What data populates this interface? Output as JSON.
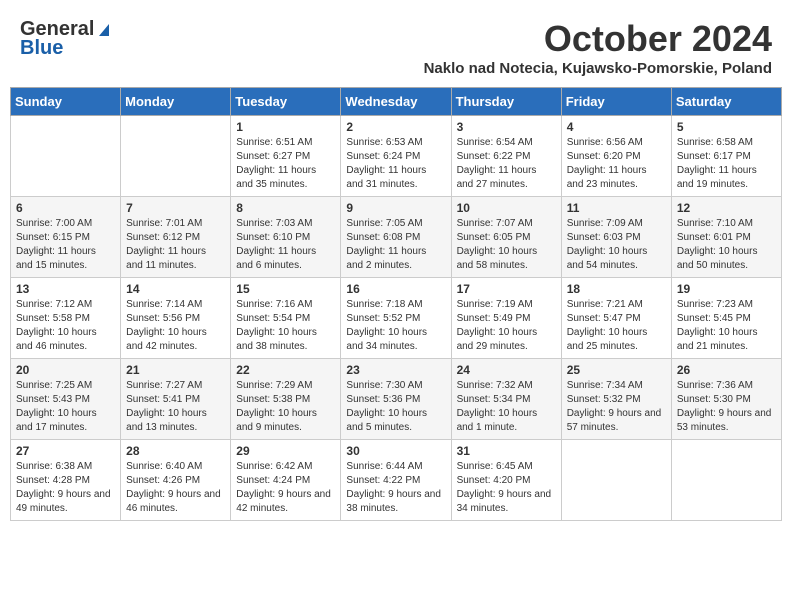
{
  "header": {
    "logo_general": "General",
    "logo_blue": "Blue",
    "month_title": "October 2024",
    "location": "Naklo nad Notecia, Kujawsko-Pomorskie, Poland"
  },
  "days_of_week": [
    "Sunday",
    "Monday",
    "Tuesday",
    "Wednesday",
    "Thursday",
    "Friday",
    "Saturday"
  ],
  "weeks": [
    [
      {
        "day": "",
        "info": ""
      },
      {
        "day": "",
        "info": ""
      },
      {
        "day": "1",
        "info": "Sunrise: 6:51 AM\nSunset: 6:27 PM\nDaylight: 11 hours and 35 minutes."
      },
      {
        "day": "2",
        "info": "Sunrise: 6:53 AM\nSunset: 6:24 PM\nDaylight: 11 hours and 31 minutes."
      },
      {
        "day": "3",
        "info": "Sunrise: 6:54 AM\nSunset: 6:22 PM\nDaylight: 11 hours and 27 minutes."
      },
      {
        "day": "4",
        "info": "Sunrise: 6:56 AM\nSunset: 6:20 PM\nDaylight: 11 hours and 23 minutes."
      },
      {
        "day": "5",
        "info": "Sunrise: 6:58 AM\nSunset: 6:17 PM\nDaylight: 11 hours and 19 minutes."
      }
    ],
    [
      {
        "day": "6",
        "info": "Sunrise: 7:00 AM\nSunset: 6:15 PM\nDaylight: 11 hours and 15 minutes."
      },
      {
        "day": "7",
        "info": "Sunrise: 7:01 AM\nSunset: 6:12 PM\nDaylight: 11 hours and 11 minutes."
      },
      {
        "day": "8",
        "info": "Sunrise: 7:03 AM\nSunset: 6:10 PM\nDaylight: 11 hours and 6 minutes."
      },
      {
        "day": "9",
        "info": "Sunrise: 7:05 AM\nSunset: 6:08 PM\nDaylight: 11 hours and 2 minutes."
      },
      {
        "day": "10",
        "info": "Sunrise: 7:07 AM\nSunset: 6:05 PM\nDaylight: 10 hours and 58 minutes."
      },
      {
        "day": "11",
        "info": "Sunrise: 7:09 AM\nSunset: 6:03 PM\nDaylight: 10 hours and 54 minutes."
      },
      {
        "day": "12",
        "info": "Sunrise: 7:10 AM\nSunset: 6:01 PM\nDaylight: 10 hours and 50 minutes."
      }
    ],
    [
      {
        "day": "13",
        "info": "Sunrise: 7:12 AM\nSunset: 5:58 PM\nDaylight: 10 hours and 46 minutes."
      },
      {
        "day": "14",
        "info": "Sunrise: 7:14 AM\nSunset: 5:56 PM\nDaylight: 10 hours and 42 minutes."
      },
      {
        "day": "15",
        "info": "Sunrise: 7:16 AM\nSunset: 5:54 PM\nDaylight: 10 hours and 38 minutes."
      },
      {
        "day": "16",
        "info": "Sunrise: 7:18 AM\nSunset: 5:52 PM\nDaylight: 10 hours and 34 minutes."
      },
      {
        "day": "17",
        "info": "Sunrise: 7:19 AM\nSunset: 5:49 PM\nDaylight: 10 hours and 29 minutes."
      },
      {
        "day": "18",
        "info": "Sunrise: 7:21 AM\nSunset: 5:47 PM\nDaylight: 10 hours and 25 minutes."
      },
      {
        "day": "19",
        "info": "Sunrise: 7:23 AM\nSunset: 5:45 PM\nDaylight: 10 hours and 21 minutes."
      }
    ],
    [
      {
        "day": "20",
        "info": "Sunrise: 7:25 AM\nSunset: 5:43 PM\nDaylight: 10 hours and 17 minutes."
      },
      {
        "day": "21",
        "info": "Sunrise: 7:27 AM\nSunset: 5:41 PM\nDaylight: 10 hours and 13 minutes."
      },
      {
        "day": "22",
        "info": "Sunrise: 7:29 AM\nSunset: 5:38 PM\nDaylight: 10 hours and 9 minutes."
      },
      {
        "day": "23",
        "info": "Sunrise: 7:30 AM\nSunset: 5:36 PM\nDaylight: 10 hours and 5 minutes."
      },
      {
        "day": "24",
        "info": "Sunrise: 7:32 AM\nSunset: 5:34 PM\nDaylight: 10 hours and 1 minute."
      },
      {
        "day": "25",
        "info": "Sunrise: 7:34 AM\nSunset: 5:32 PM\nDaylight: 9 hours and 57 minutes."
      },
      {
        "day": "26",
        "info": "Sunrise: 7:36 AM\nSunset: 5:30 PM\nDaylight: 9 hours and 53 minutes."
      }
    ],
    [
      {
        "day": "27",
        "info": "Sunrise: 6:38 AM\nSunset: 4:28 PM\nDaylight: 9 hours and 49 minutes."
      },
      {
        "day": "28",
        "info": "Sunrise: 6:40 AM\nSunset: 4:26 PM\nDaylight: 9 hours and 46 minutes."
      },
      {
        "day": "29",
        "info": "Sunrise: 6:42 AM\nSunset: 4:24 PM\nDaylight: 9 hours and 42 minutes."
      },
      {
        "day": "30",
        "info": "Sunrise: 6:44 AM\nSunset: 4:22 PM\nDaylight: 9 hours and 38 minutes."
      },
      {
        "day": "31",
        "info": "Sunrise: 6:45 AM\nSunset: 4:20 PM\nDaylight: 9 hours and 34 minutes."
      },
      {
        "day": "",
        "info": ""
      },
      {
        "day": "",
        "info": ""
      }
    ]
  ]
}
